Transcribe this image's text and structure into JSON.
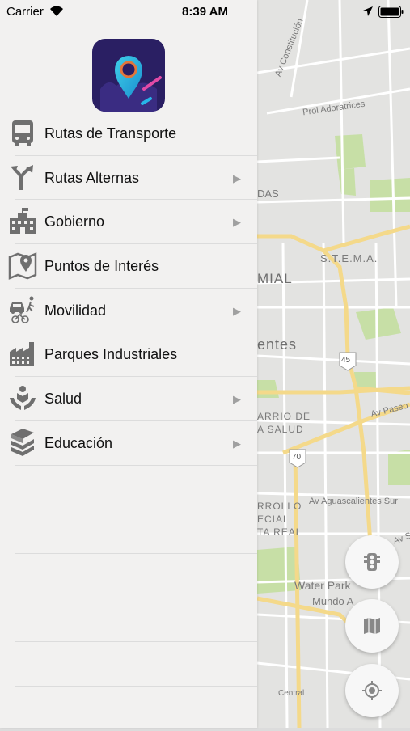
{
  "status_bar": {
    "carrier": "Carrier",
    "time": "8:39 AM"
  },
  "menu": {
    "items": [
      {
        "label": "Rutas de Transporte",
        "icon": "bus-icon",
        "has_submenu": false
      },
      {
        "label": "Rutas Alternas",
        "icon": "split-arrows-icon",
        "has_submenu": true
      },
      {
        "label": "Gobierno",
        "icon": "government-building-icon",
        "has_submenu": true
      },
      {
        "label": "Puntos de Interés",
        "icon": "map-pin-icon",
        "has_submenu": false
      },
      {
        "label": "Movilidad",
        "icon": "car-bike-walk-icon",
        "has_submenu": true
      },
      {
        "label": "Parques Industriales",
        "icon": "factory-icon",
        "has_submenu": false
      },
      {
        "label": "Salud",
        "icon": "hand-heart-icon",
        "has_submenu": true
      },
      {
        "label": "Educación",
        "icon": "books-icon",
        "has_submenu": true
      }
    ],
    "chevron": "▶"
  },
  "map": {
    "labels": {
      "av_constitucion": "Av Constitución",
      "prol_adoratrices": "Prol Adoratrices",
      "das": "DAS",
      "stema": "S.T.E.M.A.",
      "mial": "MIAL",
      "entes": "entes",
      "route_45": "45",
      "barrio_de": "ARRIO DE",
      "la_salud": "A SALUD",
      "av_paseo": "Av Paseo d",
      "route_70": "70",
      "rrollo": "RROLLO",
      "ecial": "ECIAL",
      "ta_real": "TA REAL",
      "av_aguascalientes_sur": "Av Aguascalientes Sur",
      "av_s": "Av S",
      "water_park": "Water Park",
      "mundo_a": "Mundo A",
      "central": "Central"
    },
    "road_color": "#f4d98a",
    "park_color": "#c7dfa6",
    "base_color": "#e3e3e1"
  },
  "fabs": {
    "traffic": "traffic-light-icon",
    "layers": "map-layers-icon",
    "locate": "my-location-icon"
  }
}
